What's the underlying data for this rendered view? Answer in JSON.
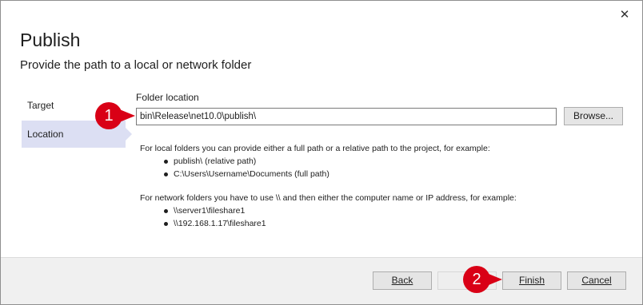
{
  "dialog": {
    "close_glyph": "✕",
    "title": "Publish",
    "subtitle": "Provide the path to a local or network folder"
  },
  "nav": {
    "items": [
      {
        "label": "Target",
        "active": false
      },
      {
        "label": "Location",
        "active": true
      }
    ]
  },
  "location": {
    "field_label": "Folder location",
    "path_value": "bin\\Release\\net10.0\\publish\\",
    "browse_label": "Browse...",
    "local_intro": "For local folders you can provide either a full path or a relative path to the project, for example:",
    "local_examples": [
      "publish\\ (relative path)",
      "C:\\Users\\Username\\Documents (full path)"
    ],
    "network_intro": "For network folders you have to use \\\\ and then either the computer name or IP address, for example:",
    "network_examples": [
      "\\\\server1\\fileshare1",
      "\\\\192.168.1.17\\fileshare1"
    ]
  },
  "footer": {
    "back_label": "Back",
    "finish_label": "Finish",
    "cancel_label": "Cancel"
  },
  "callouts": {
    "one": "1",
    "two": "2",
    "color": "#d90016"
  }
}
